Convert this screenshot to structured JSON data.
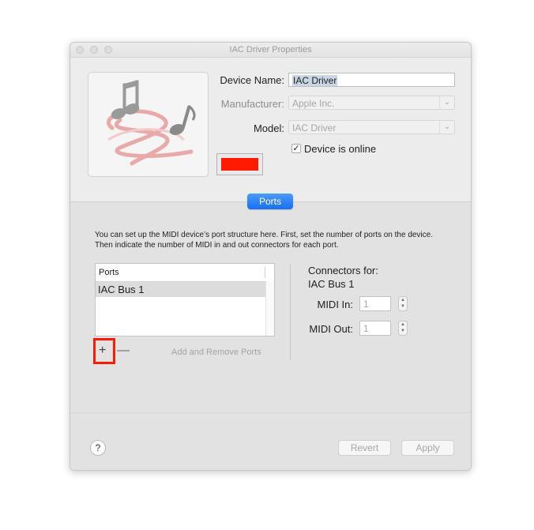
{
  "window": {
    "title": "IAC Driver Properties"
  },
  "device": {
    "name_label": "Device Name:",
    "name_value": "IAC Driver",
    "manufacturer_label": "Manufacturer:",
    "manufacturer_value": "Apple Inc.",
    "model_label": "Model:",
    "model_value": "IAC Driver",
    "online_label": "Device is online",
    "online_checked": true,
    "color": "#ff1a00"
  },
  "tabs": {
    "active": "Ports"
  },
  "ports": {
    "description": "You can set up the MIDI device’s port structure here. First, set the number of ports on the device. Then indicate the number of MIDI in and out connectors for each port.",
    "column_header": "Ports",
    "rows": [
      "IAC Bus 1"
    ],
    "add_symbol": "+",
    "remove_symbol": "—",
    "add_remove_label": "Add and Remove Ports"
  },
  "connectors": {
    "heading": "Connectors for:",
    "port_name": "IAC Bus 1",
    "midi_in_label": "MIDI In:",
    "midi_in_value": "1",
    "midi_out_label": "MIDI Out:",
    "midi_out_value": "1"
  },
  "footer": {
    "help_symbol": "?",
    "revert_label": "Revert",
    "apply_label": "Apply"
  },
  "icons": {
    "app_icon": "music-notes-swirl-icon",
    "checkbox_mark": "✓",
    "chevron": "chevron-down-icon"
  }
}
